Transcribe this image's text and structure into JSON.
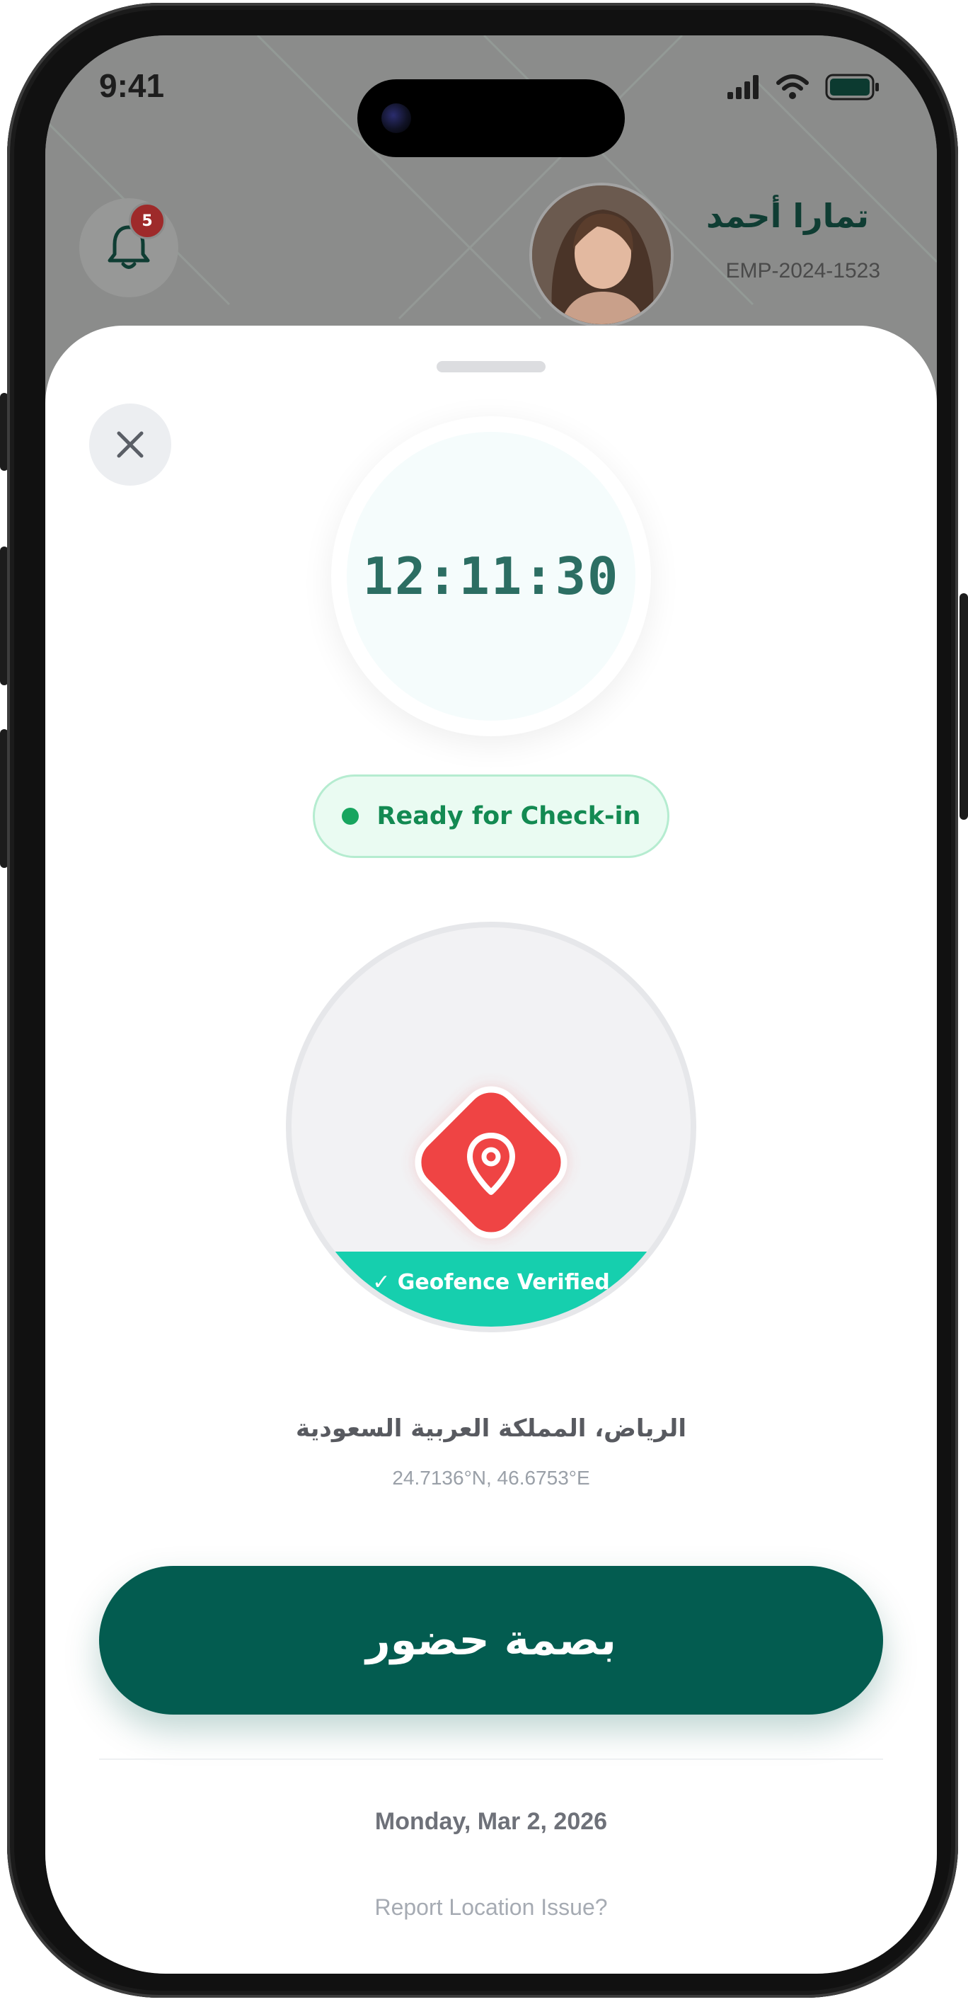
{
  "status_bar": {
    "time": "9:41"
  },
  "header": {
    "notification_count": "5",
    "user_name": "تمارا أحمد",
    "employee_id": "EMP-2024-1523"
  },
  "sheet": {
    "clock_time": "12:11:30",
    "status_text": "Ready for Check-in",
    "geofence_label": "✓ Geofence Verified",
    "location_name": "الرياض، المملكة العربية السعودية",
    "coordinates": "24.7136°N, 46.6753°E",
    "checkin_button_label": "بصمة حضور",
    "date": "Monday, Mar 2, 2026",
    "report_link": "Report Location Issue?"
  },
  "colors": {
    "primary": "#035c50",
    "accent_teal": "#16cfae",
    "pin_red": "#ef4444",
    "status_green": "#18a55f",
    "badge_red": "#9e2a2a"
  },
  "icons": [
    "bell-icon",
    "close-icon",
    "location-pin-icon",
    "signal-icon",
    "wifi-icon",
    "battery-icon"
  ]
}
